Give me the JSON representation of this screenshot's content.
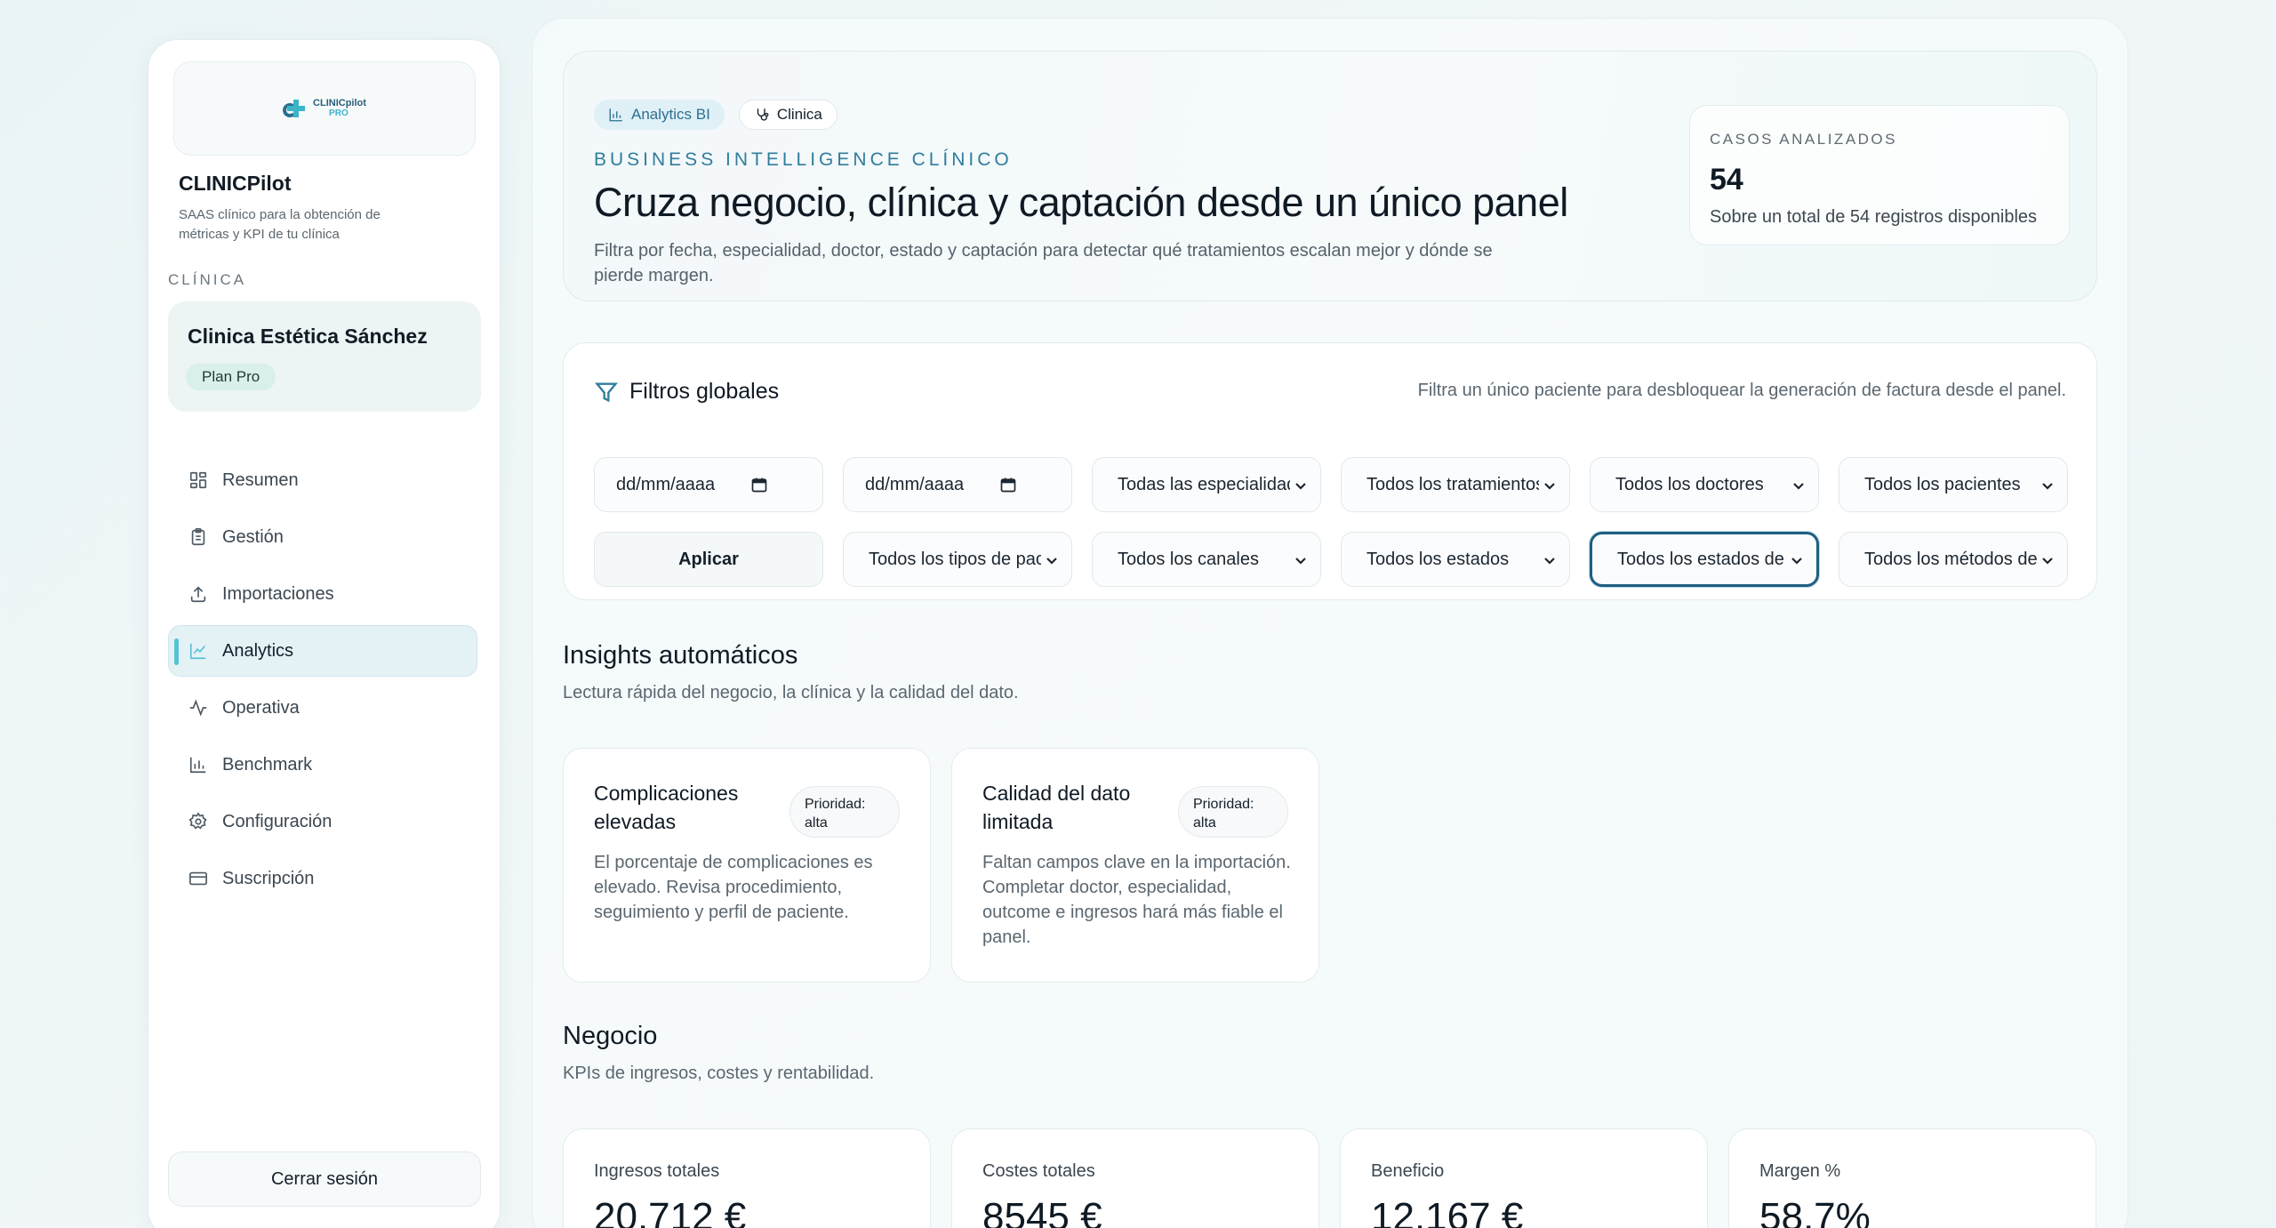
{
  "sidebar": {
    "logo_line1": "CLINICpilot",
    "logo_line2": "PRO",
    "app_name": "CLINICPilot",
    "app_description": "SAAS clínico para la obtención de métricas y KPI de tu clínica",
    "section_label": "CLÍNICA",
    "clinic_name": "Clinica Estética Sánchez",
    "plan": "Plan Pro",
    "nav": [
      {
        "label": "Resumen",
        "icon": "grid-icon"
      },
      {
        "label": "Gestión",
        "icon": "clipboard-icon"
      },
      {
        "label": "Importaciones",
        "icon": "upload-icon"
      },
      {
        "label": "Analytics",
        "icon": "line-chart-icon",
        "active": true
      },
      {
        "label": "Operativa",
        "icon": "activity-icon"
      },
      {
        "label": "Benchmark",
        "icon": "bar-chart-icon"
      },
      {
        "label": "Configuración",
        "icon": "gear-icon"
      },
      {
        "label": "Suscripción",
        "icon": "credit-card-icon"
      }
    ],
    "logout": "Cerrar sesión"
  },
  "hero": {
    "chips": [
      "Analytics BI",
      "Clinica"
    ],
    "eyebrow": "BUSINESS INTELLIGENCE CLÍNICO",
    "title": "Cruza negocio, clínica y captación desde un único panel",
    "description": "Filtra por fecha, especialidad, doctor, estado y captación para detectar qué tratamientos escalan mejor y dónde se pierde margen.",
    "cases_label": "CASOS ANALIZADOS",
    "cases_value": "54",
    "cases_sub": "Sobre un total de 54 registros disponibles"
  },
  "filters": {
    "title": "Filtros globales",
    "note": "Filtra un único paciente para desbloquear la generación de factura desde el panel.",
    "date_placeholder": "dd/mm/aaaa",
    "row1": [
      "Todas las especialidades",
      "Todos los tratamientos",
      "Todos los doctores",
      "Todos los pacientes"
    ],
    "apply": "Aplicar",
    "row2": [
      "Todos los tipos de paciente",
      "Todos los canales",
      "Todos los estados",
      "Todos los estados de pago",
      "Todos los métodos de pago"
    ]
  },
  "insights": {
    "title": "Insights automáticos",
    "subtitle": "Lectura rápida del negocio, la clínica y la calidad del dato.",
    "cards": [
      {
        "title": "Complicaciones elevadas",
        "priority": "Prioridad: alta",
        "body": "El porcentaje de complicaciones es elevado. Revisa procedimiento, seguimiento y perfil de paciente."
      },
      {
        "title": "Calidad del dato limitada",
        "priority": "Prioridad: alta",
        "body": "Faltan campos clave en la importación. Completar doctor, especialidad, outcome e ingresos hará más fiable el panel."
      }
    ]
  },
  "negocio": {
    "title": "Negocio",
    "subtitle": "KPIs de ingresos, costes y rentabilidad.",
    "kpis": [
      {
        "label": "Ingresos totales",
        "value": "20.712 €"
      },
      {
        "label": "Costes totales",
        "value": "8545 €"
      },
      {
        "label": "Beneficio",
        "value": "12.167 €"
      },
      {
        "label": "Margen %",
        "value": "58,7%"
      }
    ]
  }
}
